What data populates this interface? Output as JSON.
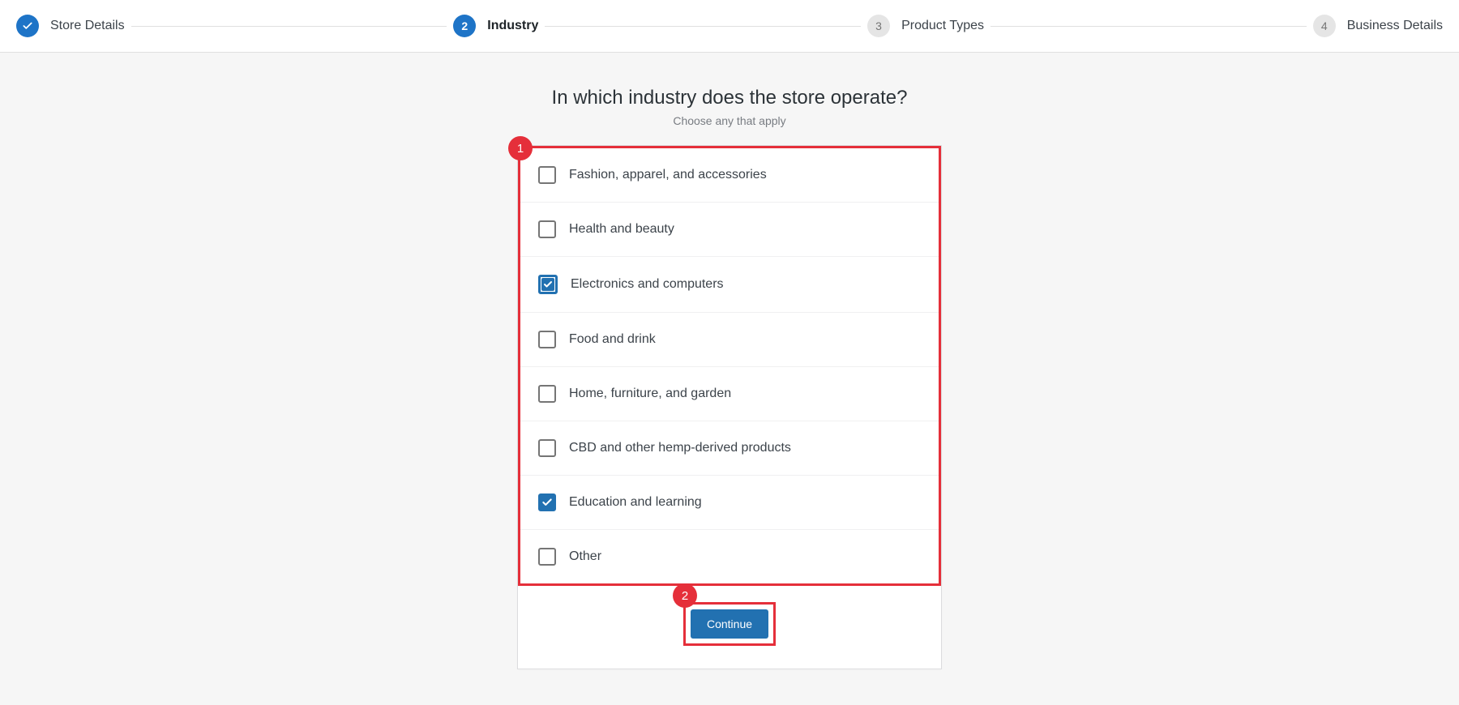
{
  "stepper": {
    "steps": [
      {
        "label": "Store Details",
        "status": "completed",
        "indicator": "✓"
      },
      {
        "label": "Industry",
        "status": "current",
        "indicator": "2"
      },
      {
        "label": "Product Types",
        "status": "upcoming",
        "indicator": "3"
      },
      {
        "label": "Business Details",
        "status": "upcoming",
        "indicator": "4"
      }
    ]
  },
  "page": {
    "title": "In which industry does the store operate?",
    "subtitle": "Choose any that apply"
  },
  "options": [
    {
      "label": "Fashion, apparel, and accessories",
      "checked": false,
      "focused": false
    },
    {
      "label": "Health and beauty",
      "checked": false,
      "focused": false
    },
    {
      "label": "Electronics and computers",
      "checked": true,
      "focused": true
    },
    {
      "label": "Food and drink",
      "checked": false,
      "focused": false
    },
    {
      "label": "Home, furniture, and garden",
      "checked": false,
      "focused": false
    },
    {
      "label": "CBD and other hemp-derived products",
      "checked": false,
      "focused": false
    },
    {
      "label": "Education and learning",
      "checked": true,
      "focused": false
    },
    {
      "label": "Other",
      "checked": false,
      "focused": false
    }
  ],
  "actions": {
    "continue_label": "Continue"
  },
  "annotations": {
    "badge1": "1",
    "badge2": "2"
  }
}
